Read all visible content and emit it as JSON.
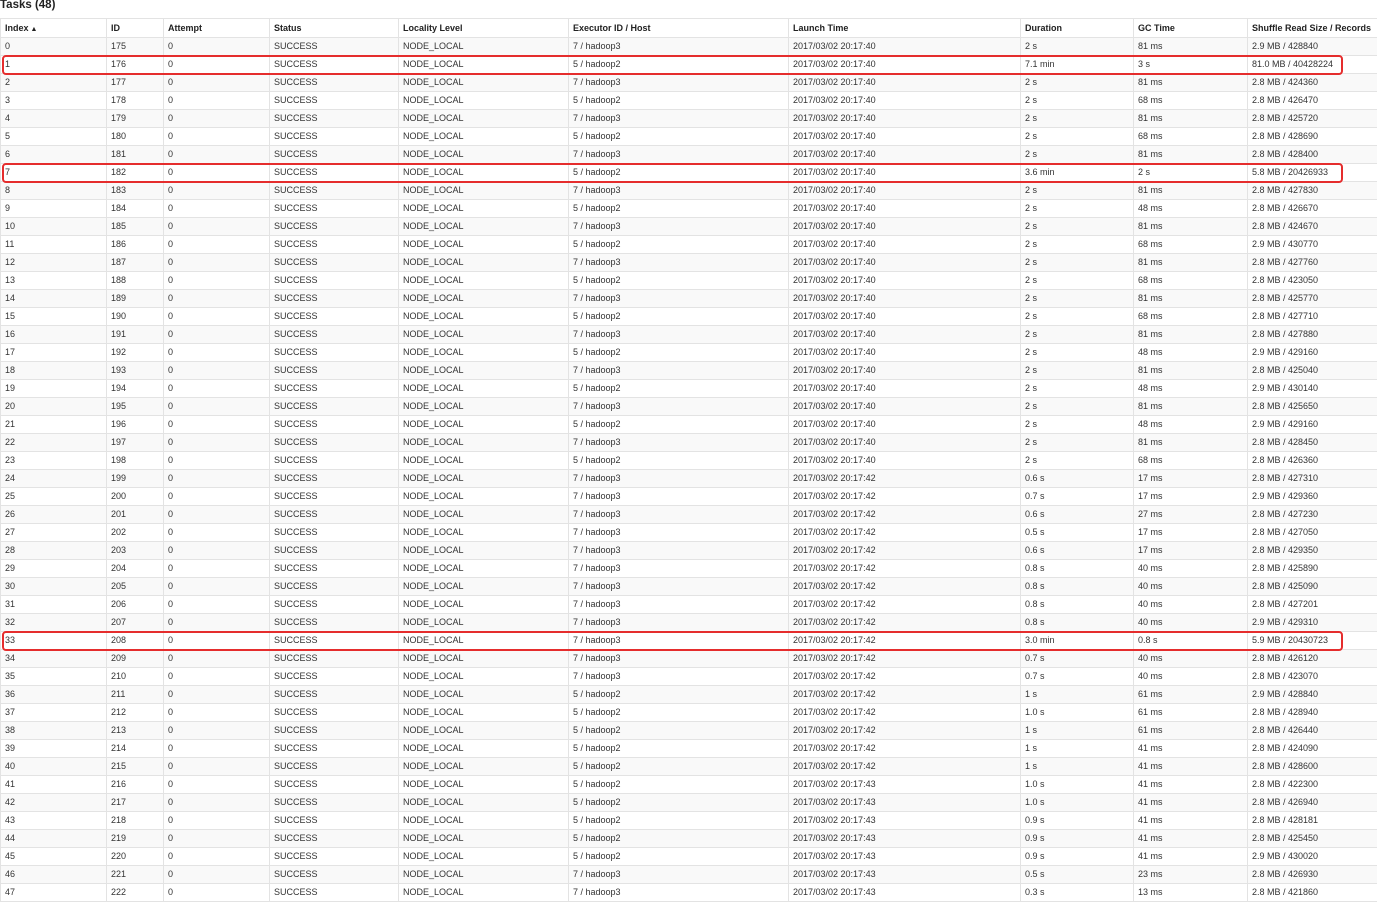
{
  "page": {
    "title": "Tasks (48)"
  },
  "table": {
    "columns": [
      {
        "label": "Index",
        "sort": "▲"
      },
      {
        "label": "ID"
      },
      {
        "label": "Attempt"
      },
      {
        "label": "Status"
      },
      {
        "label": "Locality Level"
      },
      {
        "label": "Executor ID / Host"
      },
      {
        "label": "Launch Time"
      },
      {
        "label": "Duration"
      },
      {
        "label": "GC Time"
      },
      {
        "label": "Shuffle Read Size / Records"
      }
    ],
    "rows": [
      [
        "0",
        "175",
        "0",
        "SUCCESS",
        "NODE_LOCAL",
        "7 / hadoop3",
        "2017/03/02 20:17:40",
        "2 s",
        "81 ms",
        "2.9 MB / 428840"
      ],
      [
        "1",
        "176",
        "0",
        "SUCCESS",
        "NODE_LOCAL",
        "5 / hadoop2",
        "2017/03/02 20:17:40",
        "7.1 min",
        "3 s",
        "81.0 MB / 40428224"
      ],
      [
        "2",
        "177",
        "0",
        "SUCCESS",
        "NODE_LOCAL",
        "7 / hadoop3",
        "2017/03/02 20:17:40",
        "2 s",
        "81 ms",
        "2.8 MB / 424360"
      ],
      [
        "3",
        "178",
        "0",
        "SUCCESS",
        "NODE_LOCAL",
        "5 / hadoop2",
        "2017/03/02 20:17:40",
        "2 s",
        "68 ms",
        "2.8 MB / 426470"
      ],
      [
        "4",
        "179",
        "0",
        "SUCCESS",
        "NODE_LOCAL",
        "7 / hadoop3",
        "2017/03/02 20:17:40",
        "2 s",
        "81 ms",
        "2.8 MB / 425720"
      ],
      [
        "5",
        "180",
        "0",
        "SUCCESS",
        "NODE_LOCAL",
        "5 / hadoop2",
        "2017/03/02 20:17:40",
        "2 s",
        "68 ms",
        "2.8 MB / 428690"
      ],
      [
        "6",
        "181",
        "0",
        "SUCCESS",
        "NODE_LOCAL",
        "7 / hadoop3",
        "2017/03/02 20:17:40",
        "2 s",
        "81 ms",
        "2.8 MB / 428400"
      ],
      [
        "7",
        "182",
        "0",
        "SUCCESS",
        "NODE_LOCAL",
        "5 / hadoop2",
        "2017/03/02 20:17:40",
        "3.6 min",
        "2 s",
        "5.8 MB / 20426933"
      ],
      [
        "8",
        "183",
        "0",
        "SUCCESS",
        "NODE_LOCAL",
        "7 / hadoop3",
        "2017/03/02 20:17:40",
        "2 s",
        "81 ms",
        "2.8 MB / 427830"
      ],
      [
        "9",
        "184",
        "0",
        "SUCCESS",
        "NODE_LOCAL",
        "5 / hadoop2",
        "2017/03/02 20:17:40",
        "2 s",
        "48 ms",
        "2.8 MB / 426670"
      ],
      [
        "10",
        "185",
        "0",
        "SUCCESS",
        "NODE_LOCAL",
        "7 / hadoop3",
        "2017/03/02 20:17:40",
        "2 s",
        "81 ms",
        "2.8 MB / 424670"
      ],
      [
        "11",
        "186",
        "0",
        "SUCCESS",
        "NODE_LOCAL",
        "5 / hadoop2",
        "2017/03/02 20:17:40",
        "2 s",
        "68 ms",
        "2.9 MB / 430770"
      ],
      [
        "12",
        "187",
        "0",
        "SUCCESS",
        "NODE_LOCAL",
        "7 / hadoop3",
        "2017/03/02 20:17:40",
        "2 s",
        "81 ms",
        "2.8 MB / 427760"
      ],
      [
        "13",
        "188",
        "0",
        "SUCCESS",
        "NODE_LOCAL",
        "5 / hadoop2",
        "2017/03/02 20:17:40",
        "2 s",
        "68 ms",
        "2.8 MB / 423050"
      ],
      [
        "14",
        "189",
        "0",
        "SUCCESS",
        "NODE_LOCAL",
        "7 / hadoop3",
        "2017/03/02 20:17:40",
        "2 s",
        "81 ms",
        "2.8 MB / 425770"
      ],
      [
        "15",
        "190",
        "0",
        "SUCCESS",
        "NODE_LOCAL",
        "5 / hadoop2",
        "2017/03/02 20:17:40",
        "2 s",
        "68 ms",
        "2.8 MB / 427710"
      ],
      [
        "16",
        "191",
        "0",
        "SUCCESS",
        "NODE_LOCAL",
        "7 / hadoop3",
        "2017/03/02 20:17:40",
        "2 s",
        "81 ms",
        "2.8 MB / 427880"
      ],
      [
        "17",
        "192",
        "0",
        "SUCCESS",
        "NODE_LOCAL",
        "5 / hadoop2",
        "2017/03/02 20:17:40",
        "2 s",
        "48 ms",
        "2.9 MB / 429160"
      ],
      [
        "18",
        "193",
        "0",
        "SUCCESS",
        "NODE_LOCAL",
        "7 / hadoop3",
        "2017/03/02 20:17:40",
        "2 s",
        "81 ms",
        "2.8 MB / 425040"
      ],
      [
        "19",
        "194",
        "0",
        "SUCCESS",
        "NODE_LOCAL",
        "5 / hadoop2",
        "2017/03/02 20:17:40",
        "2 s",
        "48 ms",
        "2.9 MB / 430140"
      ],
      [
        "20",
        "195",
        "0",
        "SUCCESS",
        "NODE_LOCAL",
        "7 / hadoop3",
        "2017/03/02 20:17:40",
        "2 s",
        "81 ms",
        "2.8 MB / 425650"
      ],
      [
        "21",
        "196",
        "0",
        "SUCCESS",
        "NODE_LOCAL",
        "5 / hadoop2",
        "2017/03/02 20:17:40",
        "2 s",
        "48 ms",
        "2.9 MB / 429160"
      ],
      [
        "22",
        "197",
        "0",
        "SUCCESS",
        "NODE_LOCAL",
        "7 / hadoop3",
        "2017/03/02 20:17:40",
        "2 s",
        "81 ms",
        "2.8 MB / 428450"
      ],
      [
        "23",
        "198",
        "0",
        "SUCCESS",
        "NODE_LOCAL",
        "5 / hadoop2",
        "2017/03/02 20:17:40",
        "2 s",
        "68 ms",
        "2.8 MB / 426360"
      ],
      [
        "24",
        "199",
        "0",
        "SUCCESS",
        "NODE_LOCAL",
        "7 / hadoop3",
        "2017/03/02 20:17:42",
        "0.6 s",
        "17 ms",
        "2.8 MB / 427310"
      ],
      [
        "25",
        "200",
        "0",
        "SUCCESS",
        "NODE_LOCAL",
        "7 / hadoop3",
        "2017/03/02 20:17:42",
        "0.7 s",
        "17 ms",
        "2.9 MB / 429360"
      ],
      [
        "26",
        "201",
        "0",
        "SUCCESS",
        "NODE_LOCAL",
        "7 / hadoop3",
        "2017/03/02 20:17:42",
        "0.6 s",
        "27 ms",
        "2.8 MB / 427230"
      ],
      [
        "27",
        "202",
        "0",
        "SUCCESS",
        "NODE_LOCAL",
        "7 / hadoop3",
        "2017/03/02 20:17:42",
        "0.5 s",
        "17 ms",
        "2.8 MB / 427050"
      ],
      [
        "28",
        "203",
        "0",
        "SUCCESS",
        "NODE_LOCAL",
        "7 / hadoop3",
        "2017/03/02 20:17:42",
        "0.6 s",
        "17 ms",
        "2.8 MB / 429350"
      ],
      [
        "29",
        "204",
        "0",
        "SUCCESS",
        "NODE_LOCAL",
        "7 / hadoop3",
        "2017/03/02 20:17:42",
        "0.8 s",
        "40 ms",
        "2.8 MB / 425890"
      ],
      [
        "30",
        "205",
        "0",
        "SUCCESS",
        "NODE_LOCAL",
        "7 / hadoop3",
        "2017/03/02 20:17:42",
        "0.8 s",
        "40 ms",
        "2.8 MB / 425090"
      ],
      [
        "31",
        "206",
        "0",
        "SUCCESS",
        "NODE_LOCAL",
        "7 / hadoop3",
        "2017/03/02 20:17:42",
        "0.8 s",
        "40 ms",
        "2.8 MB / 427201"
      ],
      [
        "32",
        "207",
        "0",
        "SUCCESS",
        "NODE_LOCAL",
        "7 / hadoop3",
        "2017/03/02 20:17:42",
        "0.8 s",
        "40 ms",
        "2.9 MB / 429310"
      ],
      [
        "33",
        "208",
        "0",
        "SUCCESS",
        "NODE_LOCAL",
        "7 / hadoop3",
        "2017/03/02 20:17:42",
        "3.0 min",
        "0.8 s",
        "5.9 MB / 20430723"
      ],
      [
        "34",
        "209",
        "0",
        "SUCCESS",
        "NODE_LOCAL",
        "7 / hadoop3",
        "2017/03/02 20:17:42",
        "0.7 s",
        "40 ms",
        "2.8 MB / 426120"
      ],
      [
        "35",
        "210",
        "0",
        "SUCCESS",
        "NODE_LOCAL",
        "7 / hadoop3",
        "2017/03/02 20:17:42",
        "0.7 s",
        "40 ms",
        "2.8 MB / 423070"
      ],
      [
        "36",
        "211",
        "0",
        "SUCCESS",
        "NODE_LOCAL",
        "5 / hadoop2",
        "2017/03/02 20:17:42",
        "1 s",
        "61 ms",
        "2.9 MB / 428840"
      ],
      [
        "37",
        "212",
        "0",
        "SUCCESS",
        "NODE_LOCAL",
        "5 / hadoop2",
        "2017/03/02 20:17:42",
        "1.0 s",
        "61 ms",
        "2.8 MB / 428940"
      ],
      [
        "38",
        "213",
        "0",
        "SUCCESS",
        "NODE_LOCAL",
        "5 / hadoop2",
        "2017/03/02 20:17:42",
        "1 s",
        "61 ms",
        "2.8 MB / 426440"
      ],
      [
        "39",
        "214",
        "0",
        "SUCCESS",
        "NODE_LOCAL",
        "5 / hadoop2",
        "2017/03/02 20:17:42",
        "1 s",
        "41 ms",
        "2.8 MB / 424090"
      ],
      [
        "40",
        "215",
        "0",
        "SUCCESS",
        "NODE_LOCAL",
        "5 / hadoop2",
        "2017/03/02 20:17:42",
        "1 s",
        "41 ms",
        "2.8 MB / 428600"
      ],
      [
        "41",
        "216",
        "0",
        "SUCCESS",
        "NODE_LOCAL",
        "5 / hadoop2",
        "2017/03/02 20:17:43",
        "1.0 s",
        "41 ms",
        "2.8 MB / 422300"
      ],
      [
        "42",
        "217",
        "0",
        "SUCCESS",
        "NODE_LOCAL",
        "5 / hadoop2",
        "2017/03/02 20:17:43",
        "1.0 s",
        "41 ms",
        "2.8 MB / 426940"
      ],
      [
        "43",
        "218",
        "0",
        "SUCCESS",
        "NODE_LOCAL",
        "5 / hadoop2",
        "2017/03/02 20:17:43",
        "0.9 s",
        "41 ms",
        "2.8 MB / 428181"
      ],
      [
        "44",
        "219",
        "0",
        "SUCCESS",
        "NODE_LOCAL",
        "5 / hadoop2",
        "2017/03/02 20:17:43",
        "0.9 s",
        "41 ms",
        "2.8 MB / 425450"
      ],
      [
        "45",
        "220",
        "0",
        "SUCCESS",
        "NODE_LOCAL",
        "5 / hadoop2",
        "2017/03/02 20:17:43",
        "0.9 s",
        "41 ms",
        "2.9 MB / 430020"
      ],
      [
        "46",
        "221",
        "0",
        "SUCCESS",
        "NODE_LOCAL",
        "7 / hadoop3",
        "2017/03/02 20:17:43",
        "0.5 s",
        "23 ms",
        "2.8 MB / 426930"
      ],
      [
        "47",
        "222",
        "0",
        "SUCCESS",
        "NODE_LOCAL",
        "7 / hadoop3",
        "2017/03/02 20:17:43",
        "0.3 s",
        "13 ms",
        "2.8 MB / 421860"
      ]
    ]
  },
  "highlighted_rows": [
    1,
    7,
    33
  ],
  "colors": {
    "highlight_border": "#e52d2d",
    "row_stripe": "#f9f9f9",
    "grid_line": "#e3e3e3"
  }
}
